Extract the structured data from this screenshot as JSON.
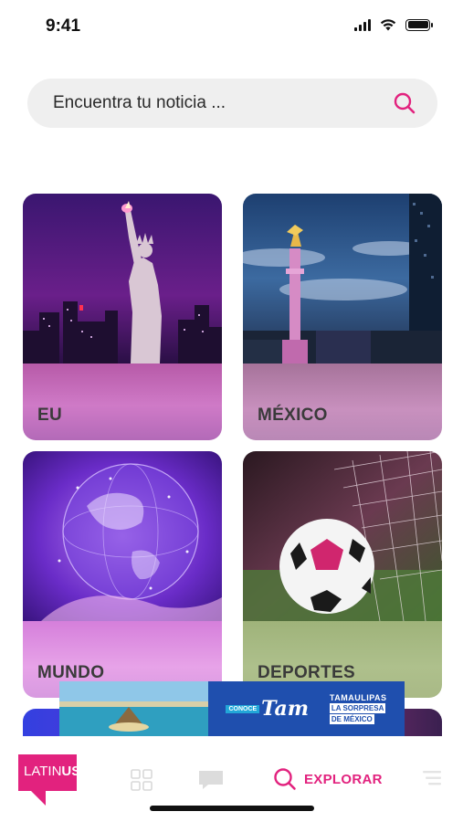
{
  "status_bar": {
    "time": "9:41",
    "icons": [
      "signal-icon",
      "wifi-icon",
      "battery-icon"
    ]
  },
  "search": {
    "placeholder": "Encuentra tu noticia ...",
    "icon": "search-icon"
  },
  "categories": [
    {
      "label": "EU",
      "image": "statue-of-liberty-night-city"
    },
    {
      "label": "MÉXICO",
      "image": "angel-de-la-independencia"
    },
    {
      "label": "MUNDO",
      "image": "digital-globe-hand"
    },
    {
      "label": "DEPORTES",
      "image": "soccer-ball-in-net"
    }
  ],
  "ad_banner": {
    "prefix": "CONOCE",
    "logo": "Tam",
    "tagline_line1": "TAMAULIPAS",
    "tagline_line2": "LA SORPRESA",
    "tagline_line3": "DE MÉXICO"
  },
  "bottom_nav": {
    "logo_part1": "LATIN",
    "logo_part2": "US",
    "explore_label": "EXPLORAR",
    "items": [
      "home-grid-icon",
      "chat-icon",
      "search-icon",
      "menu-icon"
    ]
  },
  "colors": {
    "accent": "#e2227e",
    "search_bg": "#efefef",
    "ad_blue": "#1f4fae"
  }
}
